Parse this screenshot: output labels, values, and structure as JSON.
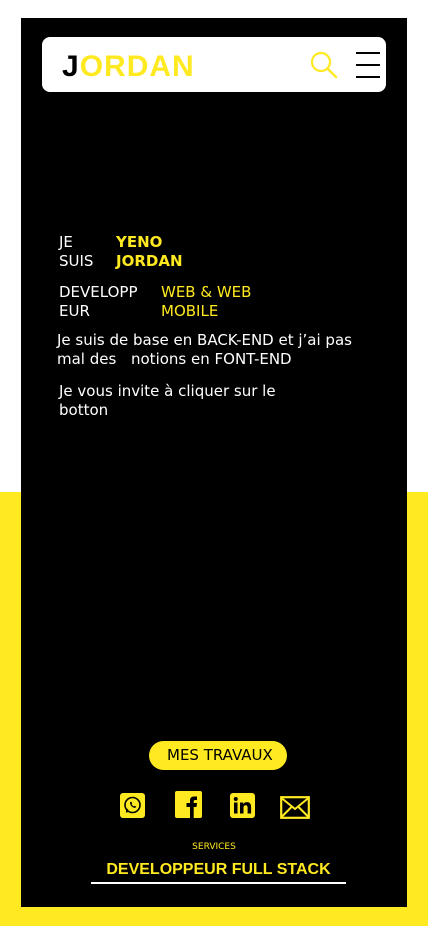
{
  "header": {
    "logo_initial": "J",
    "logo_rest": "ORDAN",
    "search_icon": "search-icon",
    "menu_icon": "hamburger-menu-icon"
  },
  "intro": {
    "je": "JE",
    "suis": "SUIS",
    "first_name": "YENO",
    "last_name": "JORDAN",
    "job_line1": "DEVELOPP",
    "job_line2": "EUR",
    "spec_line1": "WEB & WEB",
    "spec_line2": "MOBILE",
    "desc_line1": "Je suis de base en BACK-END et j’ai pas",
    "desc_line2a": "mal des",
    "desc_line2b": "notions en FONT-END",
    "invite_line1": "Je vous invite à cliquer sur le",
    "invite_line2": "botton"
  },
  "cta": {
    "label": "MES TRAVAUX"
  },
  "social": {
    "icons": [
      "whatsapp-icon",
      "facebook-icon",
      "linkedin-icon",
      "mail-icon"
    ]
  },
  "services": {
    "label": "SERVICES",
    "value": "DEVELOPPEUR FULL STACK"
  },
  "colors": {
    "accent": "#FFE921",
    "card": "#000000",
    "text": "#FFFFFF"
  }
}
